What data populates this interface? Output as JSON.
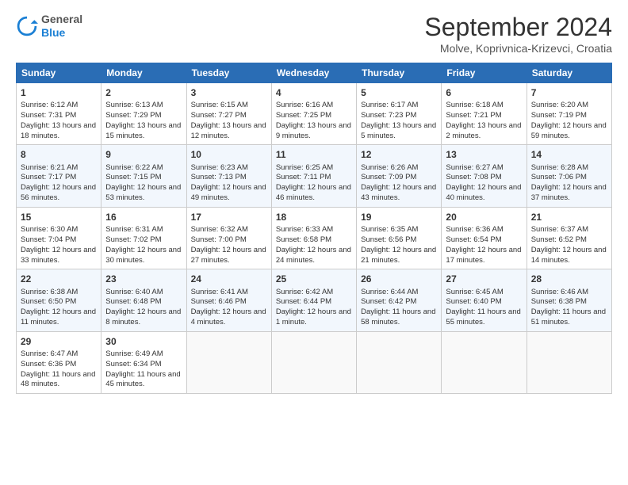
{
  "header": {
    "logo_general": "General",
    "logo_blue": "Blue",
    "month_title": "September 2024",
    "location": "Molve, Koprivnica-Krizevci, Croatia"
  },
  "weekdays": [
    "Sunday",
    "Monday",
    "Tuesday",
    "Wednesday",
    "Thursday",
    "Friday",
    "Saturday"
  ],
  "weeks": [
    [
      {
        "day": "1",
        "sunrise": "Sunrise: 6:12 AM",
        "sunset": "Sunset: 7:31 PM",
        "daylight": "Daylight: 13 hours and 18 minutes."
      },
      {
        "day": "2",
        "sunrise": "Sunrise: 6:13 AM",
        "sunset": "Sunset: 7:29 PM",
        "daylight": "Daylight: 13 hours and 15 minutes."
      },
      {
        "day": "3",
        "sunrise": "Sunrise: 6:15 AM",
        "sunset": "Sunset: 7:27 PM",
        "daylight": "Daylight: 13 hours and 12 minutes."
      },
      {
        "day": "4",
        "sunrise": "Sunrise: 6:16 AM",
        "sunset": "Sunset: 7:25 PM",
        "daylight": "Daylight: 13 hours and 9 minutes."
      },
      {
        "day": "5",
        "sunrise": "Sunrise: 6:17 AM",
        "sunset": "Sunset: 7:23 PM",
        "daylight": "Daylight: 13 hours and 5 minutes."
      },
      {
        "day": "6",
        "sunrise": "Sunrise: 6:18 AM",
        "sunset": "Sunset: 7:21 PM",
        "daylight": "Daylight: 13 hours and 2 minutes."
      },
      {
        "day": "7",
        "sunrise": "Sunrise: 6:20 AM",
        "sunset": "Sunset: 7:19 PM",
        "daylight": "Daylight: 12 hours and 59 minutes."
      }
    ],
    [
      {
        "day": "8",
        "sunrise": "Sunrise: 6:21 AM",
        "sunset": "Sunset: 7:17 PM",
        "daylight": "Daylight: 12 hours and 56 minutes."
      },
      {
        "day": "9",
        "sunrise": "Sunrise: 6:22 AM",
        "sunset": "Sunset: 7:15 PM",
        "daylight": "Daylight: 12 hours and 53 minutes."
      },
      {
        "day": "10",
        "sunrise": "Sunrise: 6:23 AM",
        "sunset": "Sunset: 7:13 PM",
        "daylight": "Daylight: 12 hours and 49 minutes."
      },
      {
        "day": "11",
        "sunrise": "Sunrise: 6:25 AM",
        "sunset": "Sunset: 7:11 PM",
        "daylight": "Daylight: 12 hours and 46 minutes."
      },
      {
        "day": "12",
        "sunrise": "Sunrise: 6:26 AM",
        "sunset": "Sunset: 7:09 PM",
        "daylight": "Daylight: 12 hours and 43 minutes."
      },
      {
        "day": "13",
        "sunrise": "Sunrise: 6:27 AM",
        "sunset": "Sunset: 7:08 PM",
        "daylight": "Daylight: 12 hours and 40 minutes."
      },
      {
        "day": "14",
        "sunrise": "Sunrise: 6:28 AM",
        "sunset": "Sunset: 7:06 PM",
        "daylight": "Daylight: 12 hours and 37 minutes."
      }
    ],
    [
      {
        "day": "15",
        "sunrise": "Sunrise: 6:30 AM",
        "sunset": "Sunset: 7:04 PM",
        "daylight": "Daylight: 12 hours and 33 minutes."
      },
      {
        "day": "16",
        "sunrise": "Sunrise: 6:31 AM",
        "sunset": "Sunset: 7:02 PM",
        "daylight": "Daylight: 12 hours and 30 minutes."
      },
      {
        "day": "17",
        "sunrise": "Sunrise: 6:32 AM",
        "sunset": "Sunset: 7:00 PM",
        "daylight": "Daylight: 12 hours and 27 minutes."
      },
      {
        "day": "18",
        "sunrise": "Sunrise: 6:33 AM",
        "sunset": "Sunset: 6:58 PM",
        "daylight": "Daylight: 12 hours and 24 minutes."
      },
      {
        "day": "19",
        "sunrise": "Sunrise: 6:35 AM",
        "sunset": "Sunset: 6:56 PM",
        "daylight": "Daylight: 12 hours and 21 minutes."
      },
      {
        "day": "20",
        "sunrise": "Sunrise: 6:36 AM",
        "sunset": "Sunset: 6:54 PM",
        "daylight": "Daylight: 12 hours and 17 minutes."
      },
      {
        "day": "21",
        "sunrise": "Sunrise: 6:37 AM",
        "sunset": "Sunset: 6:52 PM",
        "daylight": "Daylight: 12 hours and 14 minutes."
      }
    ],
    [
      {
        "day": "22",
        "sunrise": "Sunrise: 6:38 AM",
        "sunset": "Sunset: 6:50 PM",
        "daylight": "Daylight: 12 hours and 11 minutes."
      },
      {
        "day": "23",
        "sunrise": "Sunrise: 6:40 AM",
        "sunset": "Sunset: 6:48 PM",
        "daylight": "Daylight: 12 hours and 8 minutes."
      },
      {
        "day": "24",
        "sunrise": "Sunrise: 6:41 AM",
        "sunset": "Sunset: 6:46 PM",
        "daylight": "Daylight: 12 hours and 4 minutes."
      },
      {
        "day": "25",
        "sunrise": "Sunrise: 6:42 AM",
        "sunset": "Sunset: 6:44 PM",
        "daylight": "Daylight: 12 hours and 1 minute."
      },
      {
        "day": "26",
        "sunrise": "Sunrise: 6:44 AM",
        "sunset": "Sunset: 6:42 PM",
        "daylight": "Daylight: 11 hours and 58 minutes."
      },
      {
        "day": "27",
        "sunrise": "Sunrise: 6:45 AM",
        "sunset": "Sunset: 6:40 PM",
        "daylight": "Daylight: 11 hours and 55 minutes."
      },
      {
        "day": "28",
        "sunrise": "Sunrise: 6:46 AM",
        "sunset": "Sunset: 6:38 PM",
        "daylight": "Daylight: 11 hours and 51 minutes."
      }
    ],
    [
      {
        "day": "29",
        "sunrise": "Sunrise: 6:47 AM",
        "sunset": "Sunset: 6:36 PM",
        "daylight": "Daylight: 11 hours and 48 minutes."
      },
      {
        "day": "30",
        "sunrise": "Sunrise: 6:49 AM",
        "sunset": "Sunset: 6:34 PM",
        "daylight": "Daylight: 11 hours and 45 minutes."
      },
      null,
      null,
      null,
      null,
      null
    ]
  ]
}
